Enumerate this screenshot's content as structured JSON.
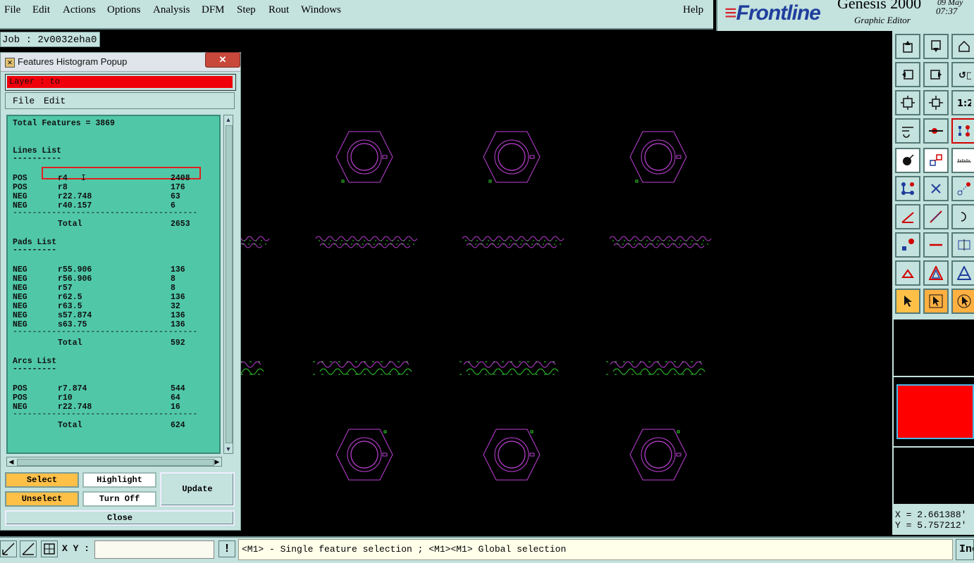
{
  "menubar": {
    "items": [
      "File",
      "Edit",
      "Actions",
      "Options",
      "Analysis",
      "DFM",
      "Step",
      "Rout",
      "Windows"
    ],
    "help": "Help"
  },
  "brand": {
    "logo": "Frontline",
    "product": "Genesis 2000",
    "subtitle": "Graphic Editor",
    "date": "09 May",
    "time": "07:37"
  },
  "job": {
    "label": "Job : 2v0032eha0"
  },
  "popup": {
    "title": "Features Histogram Popup",
    "close_glyph": "✕",
    "layer": "Layer :  to",
    "menu": [
      "File",
      "Edit"
    ],
    "total_features": "Total Features = 3869",
    "sections": [
      {
        "title": "Lines List",
        "underline": "----------",
        "rows": [
          {
            "polarity": "POS",
            "symbol": "r4",
            "count": "2408"
          },
          {
            "polarity": "POS",
            "symbol": "r8",
            "count": "176"
          },
          {
            "polarity": "NEG",
            "symbol": "r22.748",
            "count": "63"
          },
          {
            "polarity": "NEG",
            "symbol": "r40.157",
            "count": "6"
          }
        ],
        "total_label": "Total",
        "total": "2653"
      },
      {
        "title": "Pads List",
        "underline": "---------",
        "rows": [
          {
            "polarity": "NEG",
            "symbol": "r55.906",
            "count": "136"
          },
          {
            "polarity": "NEG",
            "symbol": "r56.906",
            "count": "8"
          },
          {
            "polarity": "NEG",
            "symbol": "r57",
            "count": "8"
          },
          {
            "polarity": "NEG",
            "symbol": "r62.5",
            "count": "136"
          },
          {
            "polarity": "NEG",
            "symbol": "r63.5",
            "count": "32"
          },
          {
            "polarity": "NEG",
            "symbol": "s57.874",
            "count": "136"
          },
          {
            "polarity": "NEG",
            "symbol": "s63.75",
            "count": "136"
          }
        ],
        "total_label": "Total",
        "total": "592"
      },
      {
        "title": "Arcs List",
        "underline": "---------",
        "rows": [
          {
            "polarity": "POS",
            "symbol": "r7.874",
            "count": "544"
          },
          {
            "polarity": "POS",
            "symbol": "r10",
            "count": "64"
          },
          {
            "polarity": "NEG",
            "symbol": "r22.748",
            "count": "16"
          }
        ],
        "total_label": "Total",
        "total": "624"
      }
    ],
    "separator": "--------------------------------------",
    "buttons": {
      "select": "Select",
      "unselect": "Unselect",
      "highlight": "Highlight",
      "turn_off": "Turn Off",
      "update": "Update",
      "close": "Close"
    }
  },
  "coords": {
    "x": "X = 2.661388'",
    "y": "Y = 5.757212'"
  },
  "bottombar": {
    "xy_label": "X Y :",
    "xy_value": "",
    "excl": "!",
    "message": "<M1> - Single feature selection ; <M1><M1> Global selection",
    "inc": "Inc"
  },
  "colors": {
    "panel": "#c4e2de",
    "list_bg": "#50c8a8",
    "layer_red": "#f0000a",
    "feature_magenta": "#c040d8",
    "feature_green": "#30d030",
    "button_orange": "#ffc048"
  },
  "tools": [
    "move-up-icon",
    "move-down-icon",
    "home-icon",
    "pan-left-icon",
    "pan-right-icon",
    "undo-zoom-icon",
    "fit-screen-icon",
    "zoom-center-icon",
    "scale-1-2-icon",
    "edit-tools-icon",
    "snap-point-icon",
    "net-icon",
    "pad-icon",
    "resize-icon",
    "ruler-icon",
    "connect-icon",
    "cross-icon",
    "measure-icon",
    "line-angle-icon",
    "slash-icon",
    "rotate-icon",
    "point-select-icon",
    "horizontal-line-icon",
    "mirror-icon",
    "triangle-small-icon",
    "triangle-icon",
    "triangle-outline-icon",
    "pointer-icon",
    "pointer-box-icon",
    "pointer-circle-icon"
  ]
}
